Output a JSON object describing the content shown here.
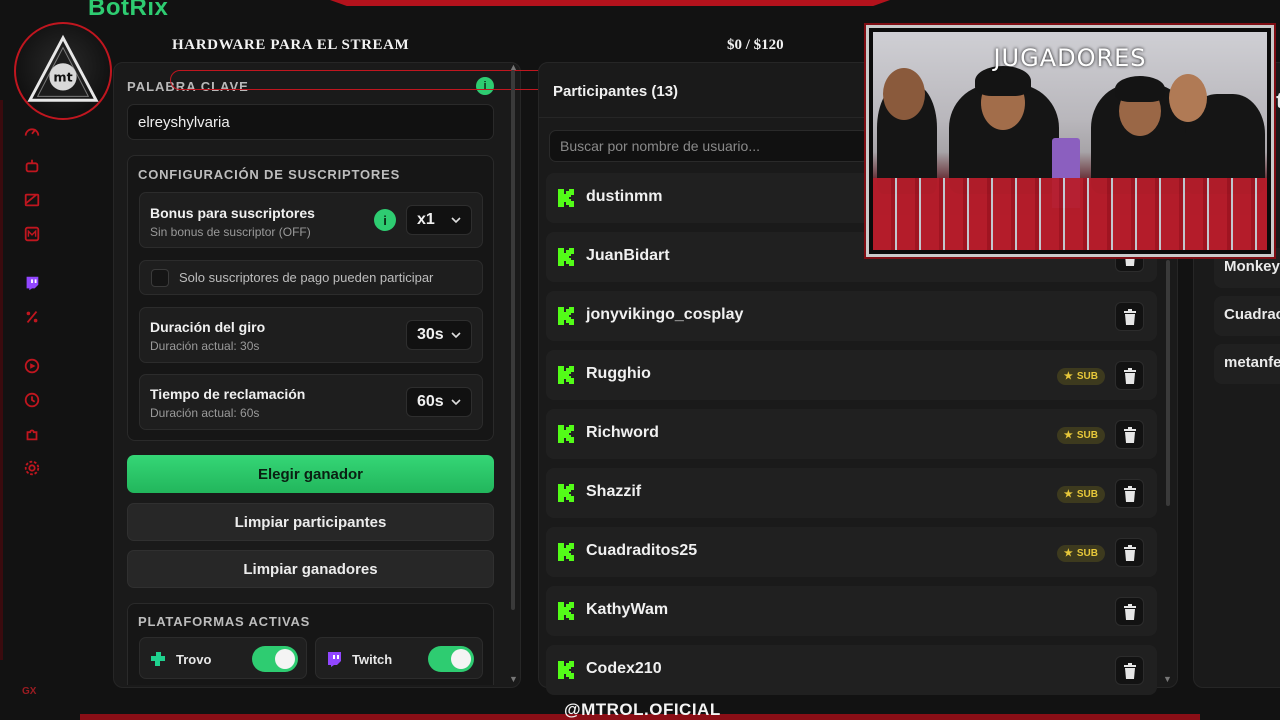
{
  "brand": "BotRix",
  "stream": {
    "title": "HARDWARE PARA EL STREAM",
    "goal": "$0 / $120"
  },
  "logo": {
    "text": "mt"
  },
  "settings": {
    "keyword_label": "PALABRA CLAVE",
    "keyword_value": "elreyshylvaria",
    "info_glyph": "i",
    "subscriber_config": {
      "title": "CONFIGURACIÓN DE SUSCRIPTORES",
      "bonus": {
        "title": "Bonus para suscriptores",
        "subtitle": "Sin bonus de suscriptor (OFF)",
        "value": "x1"
      },
      "paid_only_label": "Solo suscriptores de pago pueden participar",
      "spin_duration": {
        "title": "Duración del giro",
        "subtitle": "Duración actual: 30s",
        "value": "30s"
      },
      "claim_time": {
        "title": "Tiempo de reclamación",
        "subtitle": "Duración actual: 60s",
        "value": "60s"
      }
    },
    "buttons": {
      "pick_winner": "Elegir ganador",
      "clear_participants": "Limpiar participantes",
      "clear_winners": "Limpiar ganadores"
    },
    "platforms": {
      "title": "PLATAFORMAS ACTIVAS",
      "items": [
        {
          "name": "Trovo",
          "enabled": true,
          "color": "#1fd18e"
        },
        {
          "name": "Twitch",
          "enabled": true,
          "color": "#9146ff"
        }
      ]
    }
  },
  "participants": {
    "title": "Participantes (13)",
    "search_placeholder": "Buscar por nombre de usuario...",
    "sub_label": "SUB",
    "list": [
      {
        "name": "dustinmm",
        "sub": false
      },
      {
        "name": "JuanBidart",
        "sub": false
      },
      {
        "name": "jonyvikingo_cosplay",
        "sub": false
      },
      {
        "name": "Rugghio",
        "sub": true
      },
      {
        "name": "Richword",
        "sub": true
      },
      {
        "name": "Shazzif",
        "sub": true
      },
      {
        "name": "Cuadraditos25",
        "sub": true
      },
      {
        "name": "KathyWam",
        "sub": false
      },
      {
        "name": "Codex210",
        "sub": false
      }
    ]
  },
  "winners_partial": {
    "header_fragment": "lt",
    "items": [
      "Monkey",
      "Cuadrac",
      "metanfe"
    ]
  },
  "webcam": {
    "title": "JUGADORES"
  },
  "social_handle": "@MTROL.OFICIAL",
  "sidebar_bottom": "GX",
  "colors": {
    "accent_green": "#2ecc71",
    "frame_red": "#c0161f",
    "kick_green": "#53fc18",
    "sub_gold": "#e7c83a"
  }
}
